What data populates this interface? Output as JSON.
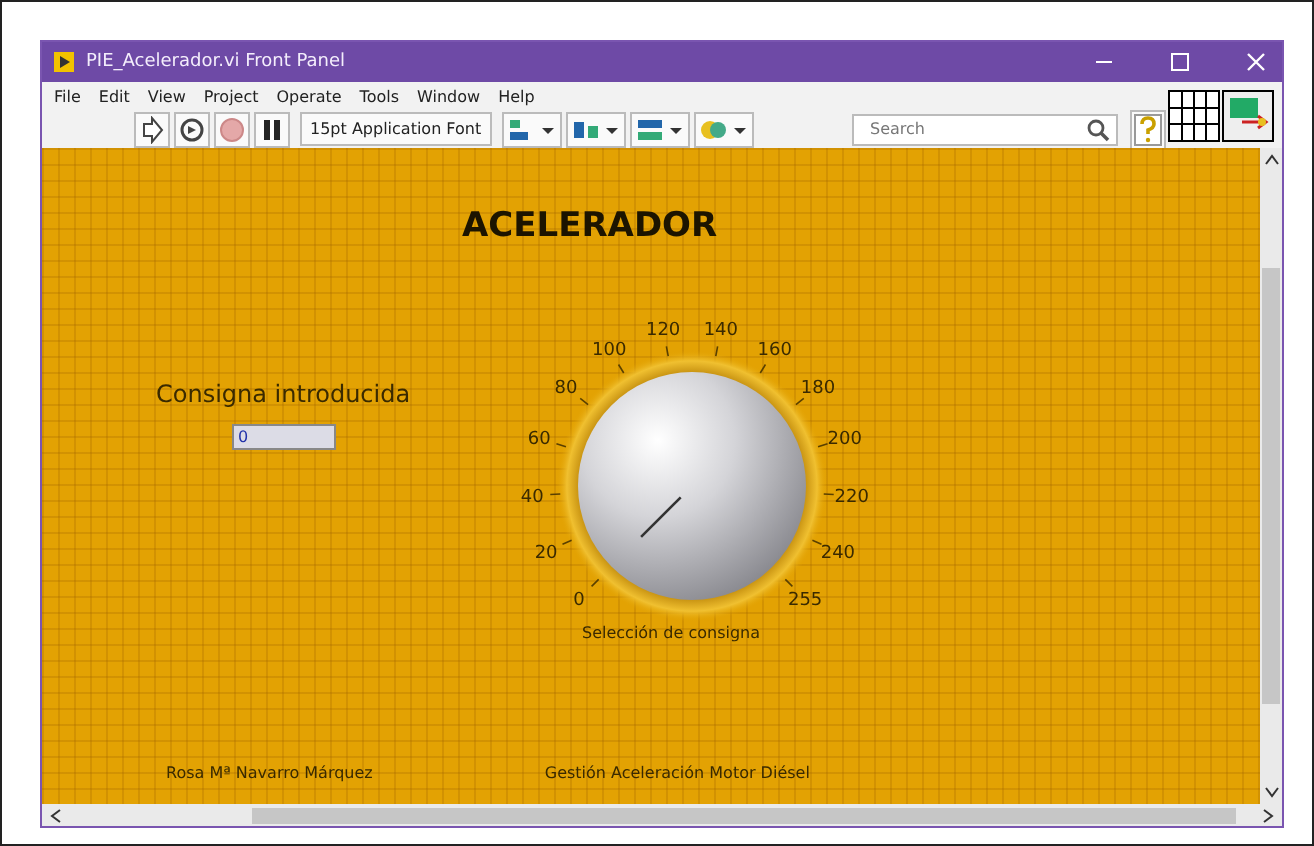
{
  "window": {
    "title": "PIE_Acelerador.vi Front Panel"
  },
  "menu": [
    "File",
    "Edit",
    "View",
    "Project",
    "Operate",
    "Tools",
    "Window",
    "Help"
  ],
  "toolbar": {
    "font": "15pt Application Font",
    "search": {
      "placeholder": "Search"
    }
  },
  "panel": {
    "title": "ACELERADOR",
    "numeric": {
      "label": "Consigna introducida",
      "value": "0"
    },
    "knob": {
      "label": "Selección de consigna",
      "scale": [
        "0",
        "20",
        "40",
        "60",
        "80",
        "100",
        "120",
        "140",
        "160",
        "180",
        "200",
        "220",
        "240",
        "255"
      ]
    },
    "footer": [
      "Rosa Mª Navarro Márquez",
      "Gestión Aceleración Motor Diésel"
    ]
  }
}
